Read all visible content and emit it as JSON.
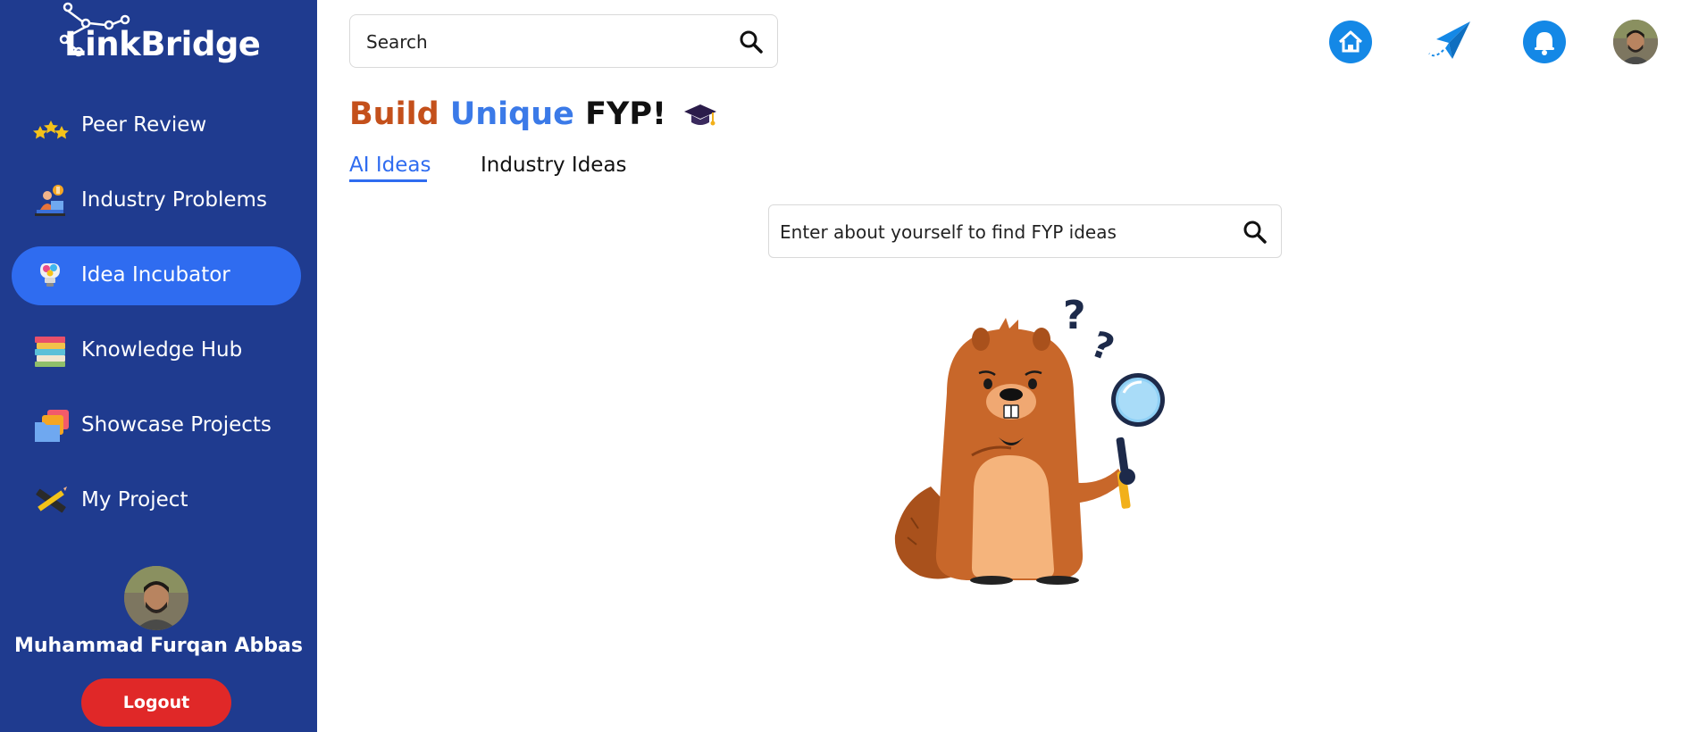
{
  "app": {
    "name": "LinkBridge"
  },
  "sidebar": {
    "items": [
      {
        "label": "Peer Review",
        "icon": "stars-icon",
        "active": false
      },
      {
        "label": "Industry Problems",
        "icon": "worker-desk-icon",
        "active": false
      },
      {
        "label": "Idea Incubator",
        "icon": "lightbulb-icon",
        "active": true
      },
      {
        "label": "Knowledge Hub",
        "icon": "books-icon",
        "active": false
      },
      {
        "label": "Showcase Projects",
        "icon": "folders-icon",
        "active": false
      },
      {
        "label": "My Project",
        "icon": "pencil-ruler-icon",
        "active": false
      }
    ],
    "user": {
      "name": "Muhammad Furqan Abbas"
    },
    "logout_label": "Logout"
  },
  "topbar": {
    "search_placeholder": "Search",
    "icons": [
      "home-icon",
      "paper-plane-icon",
      "bell-icon",
      "avatar"
    ]
  },
  "main": {
    "heading": {
      "part1": "Build",
      "part2": "Unique",
      "part3": "FYP!"
    },
    "tabs": [
      {
        "label": "AI Ideas",
        "active": true
      },
      {
        "label": "Industry Ideas",
        "active": false
      }
    ],
    "idea_search_placeholder": "Enter about yourself to find FYP ideas",
    "illustration": "beaver-with-magnifier"
  },
  "colors": {
    "sidebar_bg": "#1f3b8f",
    "active_item": "#2f6cf0",
    "logout": "#e02828",
    "heading_orange": "#c4501b",
    "heading_blue": "#3b7ae8",
    "icon_blue": "#1488e6"
  }
}
